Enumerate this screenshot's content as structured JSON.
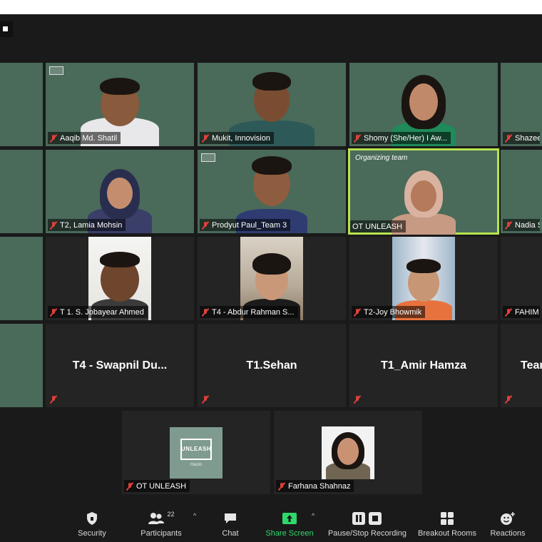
{
  "colors": {
    "mute_red": "#e0403a",
    "active_speaker_border": "#b7e34f",
    "share_screen_green": "#2fd86a",
    "background": "#1a1a1a"
  },
  "gallery": {
    "row1": [
      {
        "name": ""
      },
      {
        "name": "Aaqib Md. Shatil",
        "muted": true
      },
      {
        "name": "Mukit, Innovision",
        "muted": true
      },
      {
        "name": "Shomy (She/Her) I Aw...",
        "muted": true
      },
      {
        "name": "Shazee",
        "muted": true
      }
    ],
    "row2": [
      {
        "name": ""
      },
      {
        "name": "T2, Lamia Mohsin",
        "muted": true
      },
      {
        "name": "Prodyut Paul_Team 3",
        "muted": true
      },
      {
        "name": "OT UNLEASH",
        "muted": false,
        "active": true,
        "overlay_text": "Organizing team"
      },
      {
        "name": "Nadia S",
        "muted": true
      }
    ],
    "row3": [
      {
        "name": ""
      },
      {
        "name": "T 1. S. Jobayear Ahmed",
        "muted": true
      },
      {
        "name": "T4 - Abdur Rahman S...",
        "muted": true
      },
      {
        "name": "T2-Joy Bhowmik",
        "muted": true
      },
      {
        "name": "FAHIM",
        "muted": true
      }
    ],
    "row4": [
      {
        "name": ""
      },
      {
        "name": "T4 - Swapnil Du...",
        "muted": true,
        "camera_off": true
      },
      {
        "name": "T1.Sehan",
        "muted": true,
        "camera_off": true
      },
      {
        "name": "T1_Amir Hamza",
        "muted": true,
        "camera_off": true
      },
      {
        "name": "Tear",
        "muted": true,
        "camera_off": true
      }
    ],
    "row5": [
      {
        "name": "OT UNLEASH",
        "muted": true,
        "logo_text": "UNLEASH",
        "logo_sub": "Hacks"
      },
      {
        "name": "Farhana Shahnaz",
        "muted": true
      }
    ]
  },
  "toolbar": {
    "security": {
      "label": "Security",
      "icon": "shield-icon"
    },
    "participants": {
      "label": "Participants",
      "icon": "participants-icon",
      "count": "22"
    },
    "chat": {
      "label": "Chat",
      "icon": "chat-icon"
    },
    "share_screen": {
      "label": "Share Screen",
      "icon": "share-screen-icon"
    },
    "recording": {
      "label": "Pause/Stop Recording",
      "icon": "pause-stop-icon"
    },
    "breakout": {
      "label": "Breakout Rooms",
      "icon": "breakout-rooms-icon"
    },
    "reactions": {
      "label": "Reactions",
      "icon": "reactions-icon"
    }
  }
}
